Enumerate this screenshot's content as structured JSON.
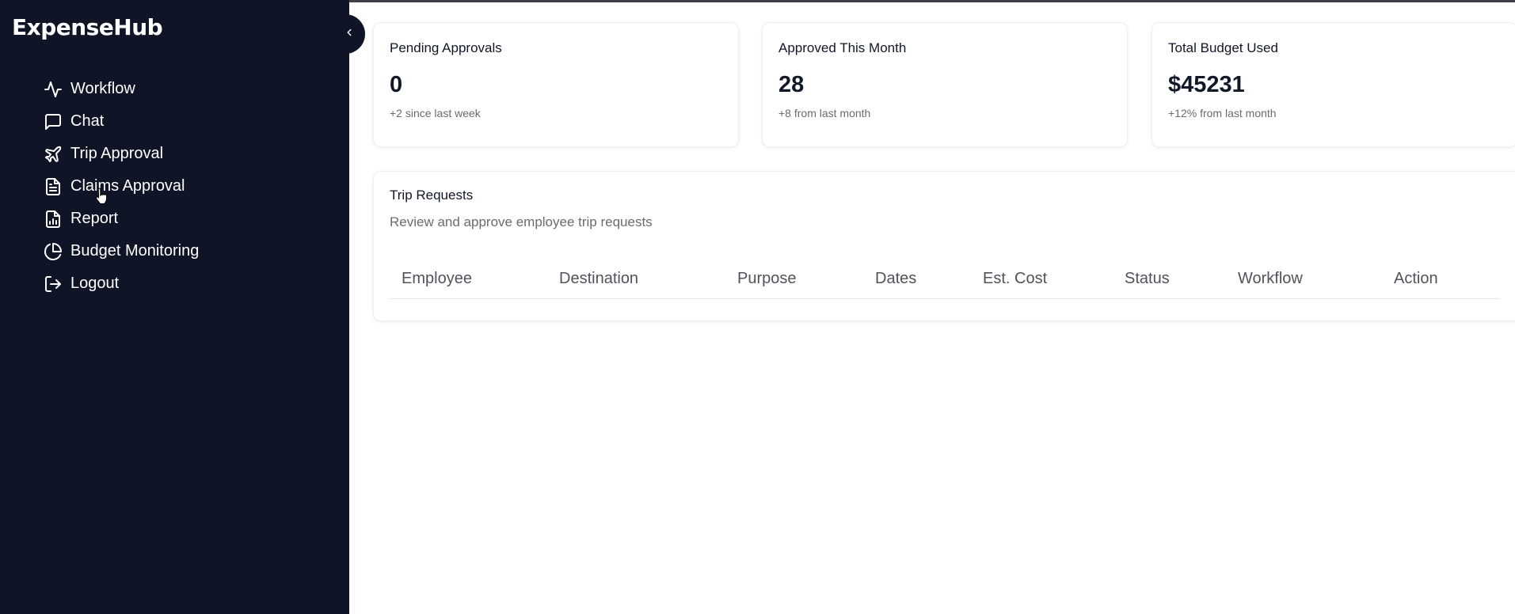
{
  "app": {
    "brand": "ExpenseHub"
  },
  "sidebar": {
    "items": [
      {
        "label": "Workflow",
        "icon": "activity-icon"
      },
      {
        "label": "Chat",
        "icon": "message-square-icon"
      },
      {
        "label": "Trip Approval",
        "icon": "plane-icon"
      },
      {
        "label": "Claims Approval",
        "icon": "file-text-icon"
      },
      {
        "label": "Report",
        "icon": "file-chart-icon"
      },
      {
        "label": "Budget Monitoring",
        "icon": "pie-chart-icon"
      },
      {
        "label": "Logout",
        "icon": "log-out-icon"
      }
    ]
  },
  "stats": [
    {
      "title": "Pending Approvals",
      "value": "0",
      "sub": "+2 since last week"
    },
    {
      "title": "Approved This Month",
      "value": "28",
      "sub": "+8 from last month"
    },
    {
      "title": "Total Budget Used",
      "value": "$45231",
      "sub": "+12% from last month"
    }
  ],
  "trip_requests": {
    "title": "Trip Requests",
    "subtitle": "Review and approve employee trip requests",
    "columns": [
      "Employee",
      "Destination",
      "Purpose",
      "Dates",
      "Est. Cost",
      "Status",
      "Workflow",
      "Action"
    ],
    "rows": []
  },
  "colors": {
    "sidebar_bg": "#0f1527",
    "text": "#111827",
    "muted": "#6b6b6b"
  }
}
